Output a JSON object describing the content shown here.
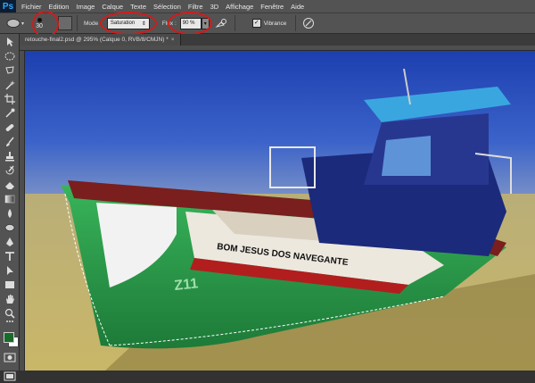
{
  "app": {
    "logo": "Ps"
  },
  "menu": [
    "Fichier",
    "Edition",
    "Image",
    "Calque",
    "Texte",
    "Sélection",
    "Filtre",
    "3D",
    "Affichage",
    "Fenêtre",
    "Aide"
  ],
  "options": {
    "brush_size": "30",
    "mode_label": "Mode :",
    "mode_value": "Saturation",
    "flux_label": "Flux :",
    "flux_value": "90 %",
    "vibrance_checked": true,
    "vibrance_label": "Vibrance"
  },
  "document": {
    "tab_title": "retouche-final2.psd @ 295% (Calque 0, RVB/8/CMJN) *",
    "close": "×"
  },
  "canvas": {
    "boat_name": "BOM JESUS DOS NAVEGANTE",
    "hull_number": "Z11"
  },
  "colors": {
    "annotation": "#d21b1b",
    "foreground": "#1a6a2a",
    "background": "#ffffff",
    "hull_green": "#2a9b4a"
  },
  "tools": [
    "move-tool",
    "marquee-tool",
    "lasso-tool",
    "quick-select-tool",
    "crop-tool",
    "eyedropper-tool",
    "healing-brush-tool",
    "brush-tool",
    "clone-stamp-tool",
    "history-brush-tool",
    "eraser-tool",
    "gradient-tool",
    "blur-tool",
    "sponge-tool",
    "pen-tool",
    "type-tool",
    "path-select-tool",
    "rectangle-tool",
    "hand-tool",
    "zoom-tool"
  ]
}
